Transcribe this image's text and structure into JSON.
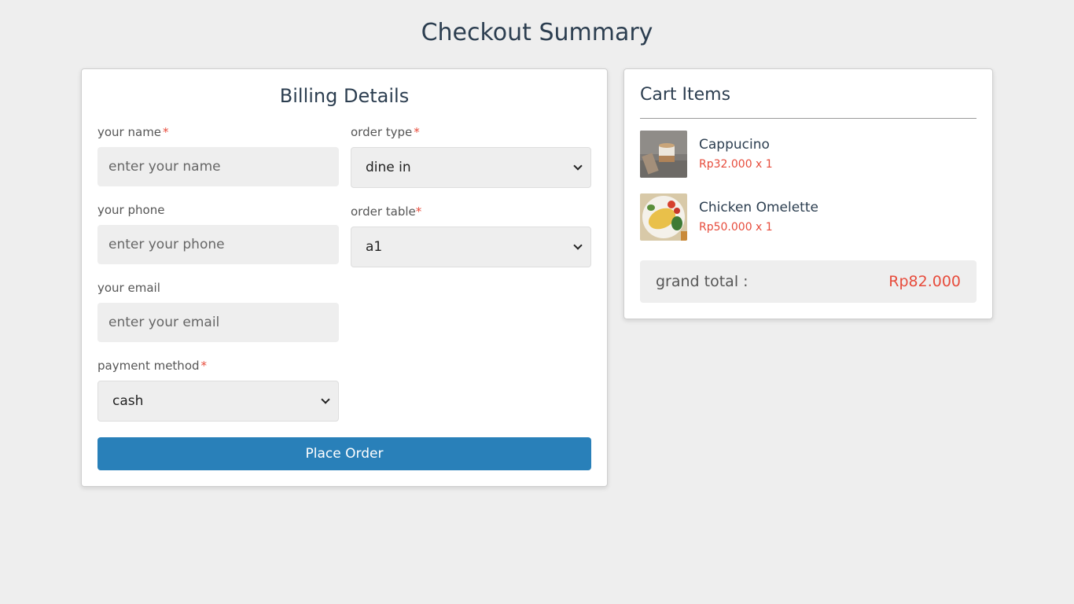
{
  "page_title": "Checkout Summary",
  "billing": {
    "title": "Billing Details",
    "name_label": "your name",
    "name_placeholder": "enter your name",
    "order_type_label": "order type",
    "order_type_value": "dine in",
    "phone_label": "your phone",
    "phone_placeholder": "enter your phone",
    "order_table_label": "order table",
    "order_table_value": "a1",
    "email_label": "your email",
    "email_placeholder": "enter your email",
    "payment_label": "payment method",
    "payment_value": "cash",
    "required_mark": "*",
    "place_order": "Place Order"
  },
  "cart": {
    "title": "Cart Items",
    "items": [
      {
        "name": "Cappucino",
        "price": "Rp32.000 x 1",
        "thumb": "coffee-cup-photo"
      },
      {
        "name": "Chicken Omelette",
        "price": "Rp50.000 x 1",
        "thumb": "omelette-plate-photo"
      }
    ],
    "total_label": "grand total :",
    "total_value": "Rp82.000"
  },
  "colors": {
    "background": "#eeeeee",
    "primary_button": "#2980b9",
    "accent_red": "#e74c3c",
    "heading": "#2c3e50"
  }
}
